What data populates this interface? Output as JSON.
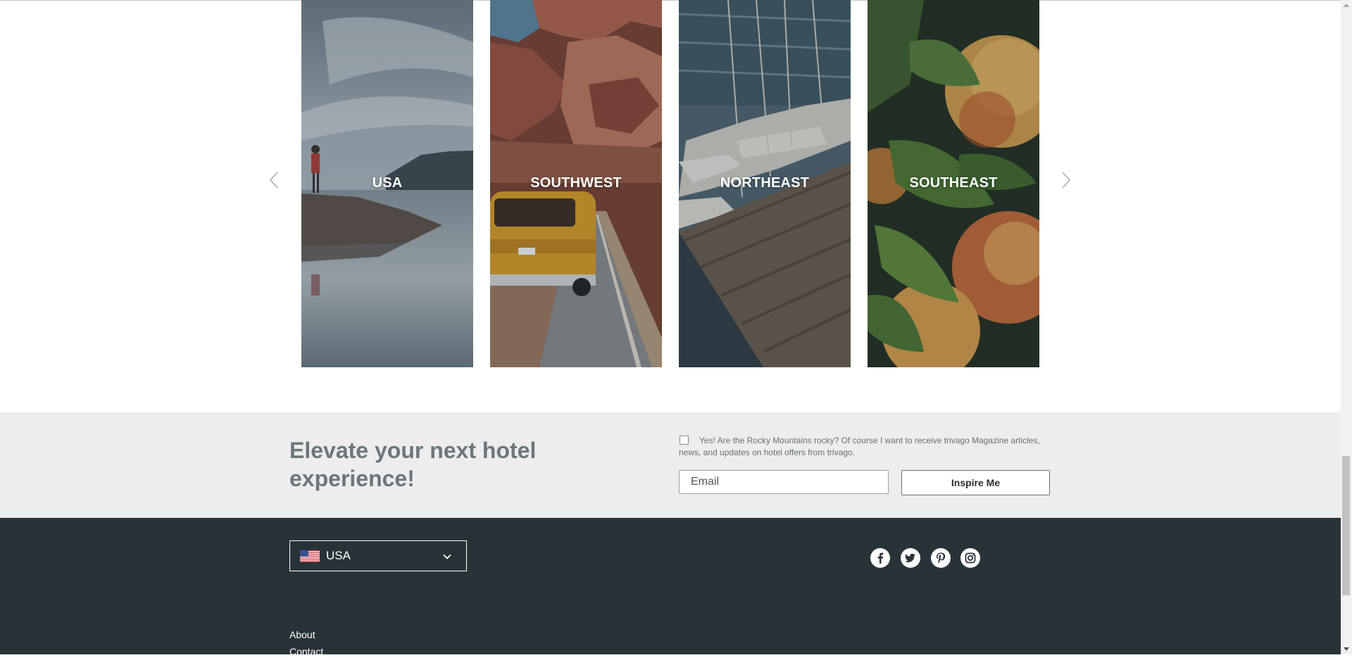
{
  "carousel": {
    "prev_icon": "chevron-left-icon",
    "next_icon": "chevron-right-icon",
    "cards": [
      {
        "label": "USA",
        "image": "lake-person-photo"
      },
      {
        "label": "SOUTHWEST",
        "image": "canyon-road-van-photo"
      },
      {
        "label": "NORTHEAST",
        "image": "marina-sailboats-photo"
      },
      {
        "label": "SOUTHEAST",
        "image": "peaches-photo"
      }
    ]
  },
  "newsletter": {
    "headline": "Elevate your next hotel experience!",
    "consent_text": "Yes! Are the Rocky Mountains rocky? Of course I want to receive trivago Magazine articles, news, and updates on hotel offers from trivago.",
    "email_placeholder": "Email",
    "email_value": "",
    "button_label": "Inspire Me"
  },
  "footer": {
    "country": {
      "name": "USA",
      "flag_icon": "us-flag-icon",
      "chevron_icon": "chevron-down-icon"
    },
    "social_icons": [
      "facebook-icon",
      "twitter-icon",
      "pinterest-icon",
      "instagram-icon"
    ],
    "links": [
      "About",
      "Contact"
    ]
  },
  "colors": {
    "newsletter_bg": "#ebedee",
    "footer_bg": "#283338",
    "headline": "#6f767a"
  }
}
